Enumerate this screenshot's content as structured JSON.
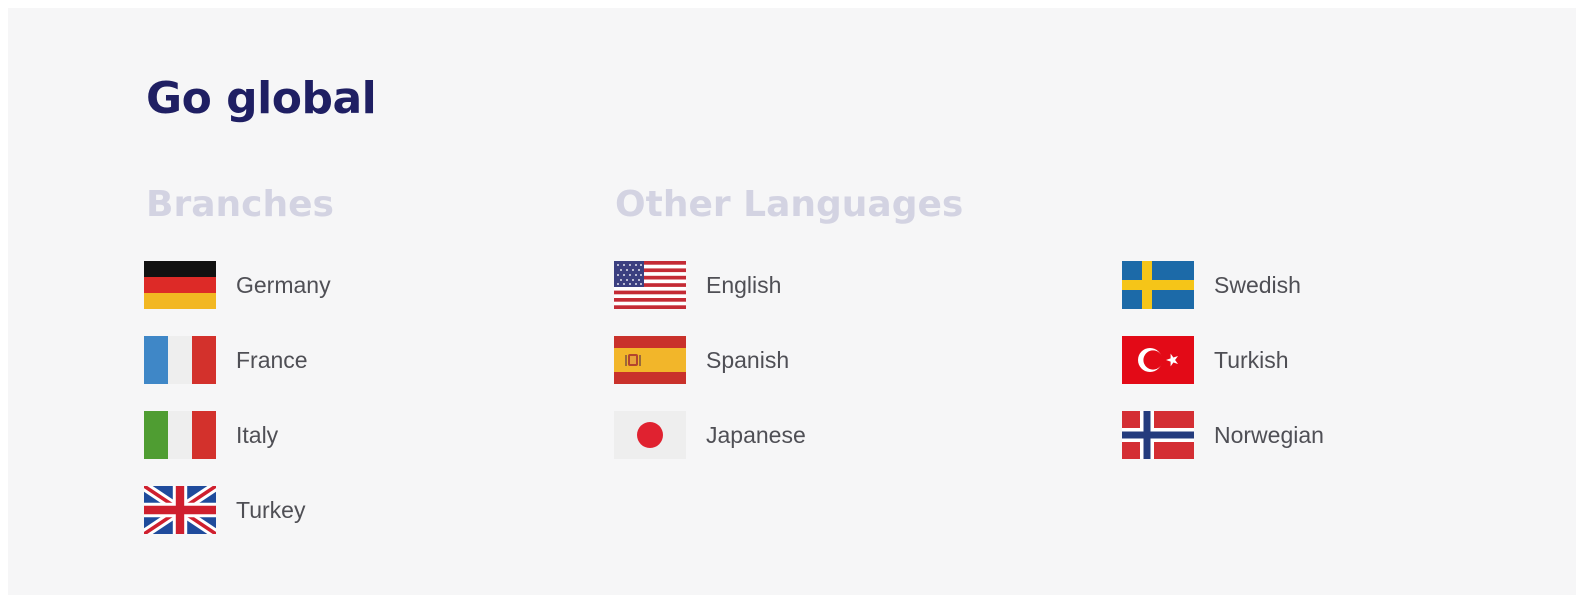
{
  "title": "Go global",
  "branches": {
    "heading": "Branches",
    "items": [
      {
        "label": "Germany",
        "flag": "germany-flag-icon"
      },
      {
        "label": "France",
        "flag": "france-flag-icon"
      },
      {
        "label": "Italy",
        "flag": "italy-flag-icon"
      },
      {
        "label": "Turkey",
        "flag": "uk-flag-icon"
      }
    ]
  },
  "languages": {
    "heading": "Other Languages",
    "items": [
      {
        "label": "English",
        "flag": "usa-flag-icon"
      },
      {
        "label": "Spanish",
        "flag": "spain-flag-icon"
      },
      {
        "label": "Japanese",
        "flag": "japan-flag-icon"
      },
      {
        "label": "Swedish",
        "flag": "sweden-flag-icon"
      },
      {
        "label": "Turkish",
        "flag": "turkey-flag-icon"
      },
      {
        "label": "Norwegian",
        "flag": "norway-flag-icon"
      }
    ]
  },
  "colors": {
    "title": "#1f1f63",
    "heading": "#d3d3e2",
    "label": "#4f4f55",
    "background": "#f6f6f7"
  }
}
